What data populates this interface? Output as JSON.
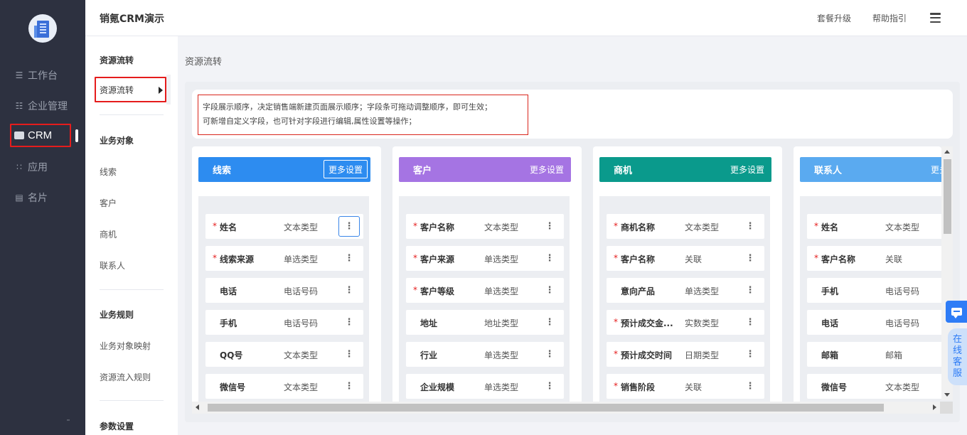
{
  "nav": {
    "items": [
      {
        "label": "工作台",
        "icon": "menu-lines-icon"
      },
      {
        "label": "企业管理",
        "icon": "org-tree-icon"
      },
      {
        "label": "CRM",
        "icon": "crm-card-icon"
      },
      {
        "label": "应用",
        "icon": "apps-grid-icon"
      },
      {
        "label": "名片",
        "icon": "card-icon"
      }
    ]
  },
  "header": {
    "title": "销氪CRM演示",
    "upgrade": "套餐升级",
    "help": "帮助指引"
  },
  "subnav": {
    "sections": [
      {
        "title": "资源流转",
        "items": [
          "资源流转"
        ]
      },
      {
        "title": "业务对象",
        "items": [
          "线索",
          "客户",
          "商机",
          "联系人"
        ]
      },
      {
        "title": "业务规则",
        "items": [
          "业务对象映射",
          "资源流入规则"
        ]
      },
      {
        "title": "参数设置",
        "items": []
      }
    ]
  },
  "main": {
    "title": "资源流转",
    "notice_line1": "字段展示顺序，决定销售端新建页面展示顺序；字段条可拖动调整顺序，即可生效；",
    "notice_line2": "可新增自定义字段，也可针对字段进行编辑,属性设置等操作；"
  },
  "columns": [
    {
      "title": "线索",
      "more": "更多设置",
      "color": "#2d8cf0",
      "fields": [
        {
          "req": "*",
          "name": "姓名",
          "type": "文本类型"
        },
        {
          "req": "*",
          "name": "线索来源",
          "type": "单选类型"
        },
        {
          "req": "",
          "name": "电话",
          "type": "电话号码"
        },
        {
          "req": "",
          "name": "手机",
          "type": "电话号码"
        },
        {
          "req": "",
          "name": "QQ号",
          "type": "文本类型"
        },
        {
          "req": "",
          "name": "微信号",
          "type": "文本类型"
        }
      ]
    },
    {
      "title": "客户",
      "more": "更多设置",
      "color": "#a574e3",
      "fields": [
        {
          "req": "*",
          "name": "客户名称",
          "type": "文本类型"
        },
        {
          "req": "*",
          "name": "客户来源",
          "type": "单选类型"
        },
        {
          "req": "*",
          "name": "客户等级",
          "type": "单选类型"
        },
        {
          "req": "",
          "name": "地址",
          "type": "地址类型"
        },
        {
          "req": "",
          "name": "行业",
          "type": "单选类型"
        },
        {
          "req": "",
          "name": "企业规模",
          "type": "单选类型"
        }
      ]
    },
    {
      "title": "商机",
      "more": "更多设置",
      "color": "#0a9a8c",
      "fields": [
        {
          "req": "*",
          "name": "商机名称",
          "type": "文本类型"
        },
        {
          "req": "*",
          "name": "客户名称",
          "type": "关联"
        },
        {
          "req": "",
          "name": "意向产品",
          "type": "单选类型"
        },
        {
          "req": "*",
          "name": "预计成交金...",
          "type": "实数类型"
        },
        {
          "req": "*",
          "name": "预计成交时间",
          "type": "日期类型"
        },
        {
          "req": "*",
          "name": "销售阶段",
          "type": "关联"
        }
      ]
    },
    {
      "title": "联系人",
      "more": "更多设置",
      "color": "#5aaaf0",
      "fields": [
        {
          "req": "*",
          "name": "姓名",
          "type": "文本类型"
        },
        {
          "req": "*",
          "name": "客户名称",
          "type": "关联"
        },
        {
          "req": "",
          "name": "手机",
          "type": "电话号码"
        },
        {
          "req": "",
          "name": "电话",
          "type": "电话号码"
        },
        {
          "req": "",
          "name": "邮箱",
          "type": "邮箱"
        },
        {
          "req": "",
          "name": "微信号",
          "type": "文本类型"
        }
      ]
    }
  ],
  "support": {
    "label": "在线客服"
  },
  "menu_glyph": "⋮"
}
